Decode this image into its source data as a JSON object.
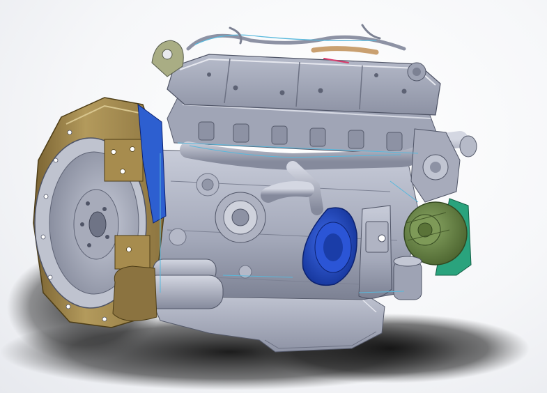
{
  "scene": {
    "subject": "cad-engine-model",
    "colors": {
      "background_light": "#ffffff",
      "background_dark": "#e4e6eb",
      "shadow": "#1a1a1a",
      "engine_body": "#a3a8b9",
      "engine_body_light": "#c4c8d6",
      "engine_body_dark": "#6d7285",
      "flywheel_housing": "#9a8147",
      "flywheel_housing_light": "#c0a867",
      "turbo_housing": "#1f49c7",
      "alternator": "#6e8a49",
      "alternator_bracket": "#2aa37d",
      "fuel_pump": "#8b7340",
      "oil_pan": "#b4b8c8",
      "highlight_edges": "#58b8dc",
      "accent_red": "#d93b6b",
      "accent_tan": "#c9a070"
    }
  }
}
